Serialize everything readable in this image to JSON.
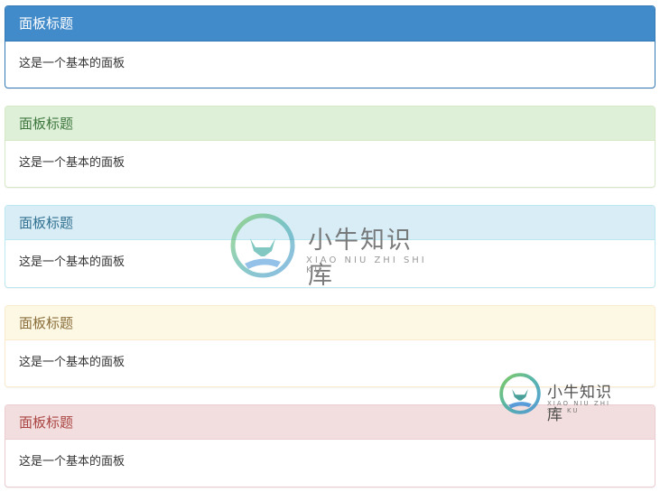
{
  "panels": [
    {
      "variant": "primary",
      "title": "面板标题",
      "body": "这是一个基本的面板"
    },
    {
      "variant": "success",
      "title": "面板标题",
      "body": "这是一个基本的面板"
    },
    {
      "variant": "info",
      "title": "面板标题",
      "body": "这是一个基本的面板"
    },
    {
      "variant": "warning",
      "title": "面板标题",
      "body": "这是一个基本的面板"
    },
    {
      "variant": "danger",
      "title": "面板标题",
      "body": "这是一个基本的面板"
    }
  ],
  "watermark": {
    "name": "小牛知识库",
    "subtitle": "XIAO NIU ZHI SHI KU",
    "colors": {
      "teal": "#3aa8a0",
      "blue": "#3e8fd6",
      "green": "#6cc24a"
    }
  },
  "colors": {
    "primary_heading": "#428bca",
    "success_heading": "#dff0d8",
    "info_heading": "#d9edf7",
    "warning_heading": "#fcf8e3",
    "danger_heading": "#f2dede"
  }
}
